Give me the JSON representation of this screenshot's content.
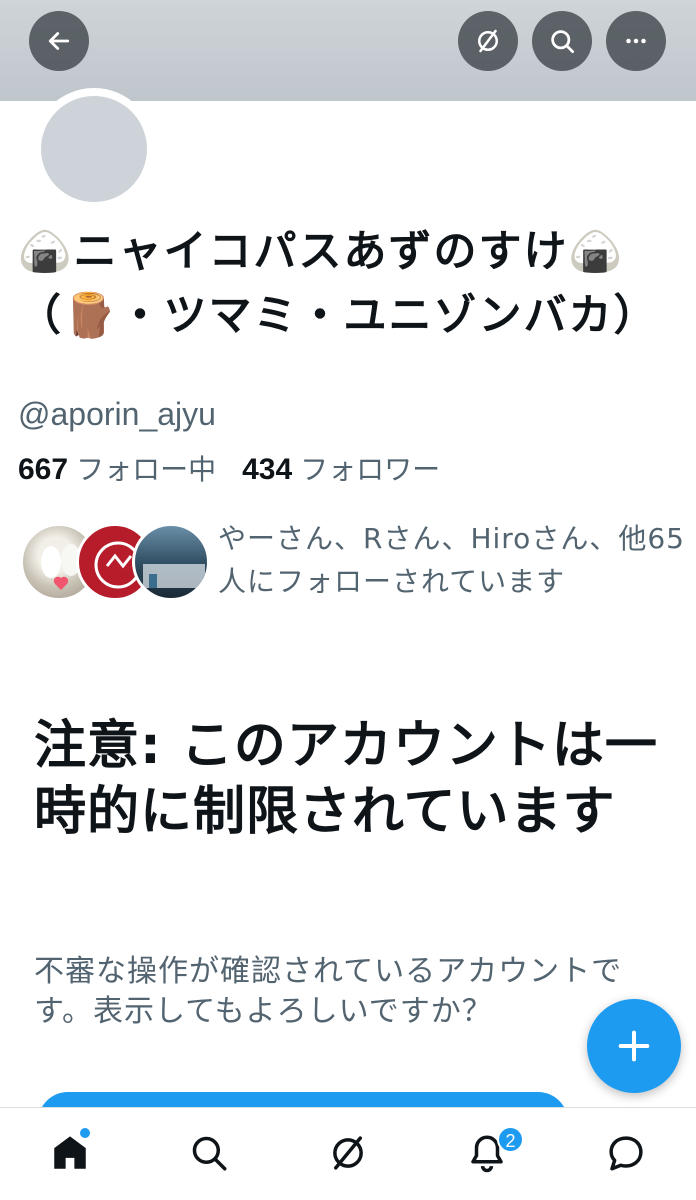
{
  "header": {
    "back_icon": "arrow-left-icon",
    "topics_icon": "lightning-circle-icon",
    "search_icon": "search-icon",
    "more_icon": "more-horizontal-icon"
  },
  "profile": {
    "display_name": "🍙ニャイコパスあずのすけ🍙（🪵・ツマミ・ユニゾンバカ）",
    "handle": "@aporin_ajyu",
    "following_count": "667",
    "following_label": "フォロー中",
    "followers_count": "434",
    "followers_label": "フォロワー"
  },
  "followers_you_know": {
    "text": "やーさん、Rさん、Hiroさん、他65人にフォローされています"
  },
  "warning": {
    "title": "注意: このアカウントは一時的に制限されています",
    "description": "不審な操作が確認されているアカウントです。表示してもよろしいですか？"
  },
  "nav": {
    "notifications_badge": "2"
  },
  "colors": {
    "accent": "#1d9bf0",
    "text_primary": "#0f1419",
    "text_secondary": "#536471",
    "banner": "#c6ccd1"
  }
}
